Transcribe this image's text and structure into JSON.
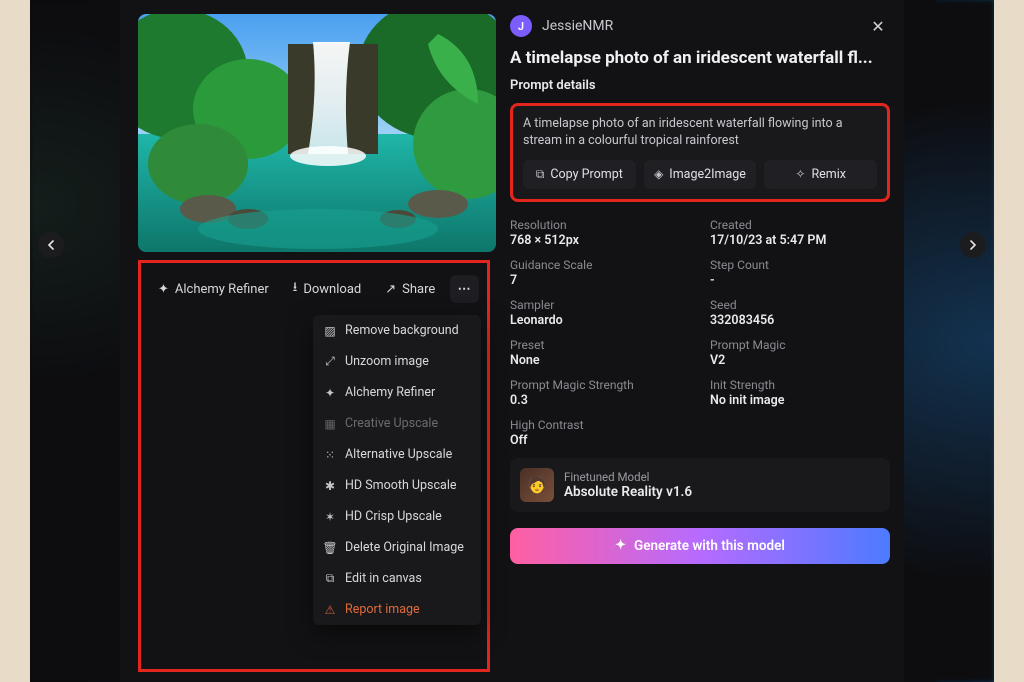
{
  "user": {
    "name": "JessieNMR",
    "initial": "J"
  },
  "title": "A timelapse photo of an iridescent waterfall fl...",
  "prompt_details_label": "Prompt details",
  "prompt_text": "A timelapse photo of an iridescent waterfall flowing into a stream in a colourful tropical rainforest",
  "prompt_actions": {
    "copy": "Copy Prompt",
    "i2i": "Image2Image",
    "remix": "Remix"
  },
  "toolbar": {
    "alchemy": "Alchemy Refiner",
    "download": "Download",
    "share": "Share"
  },
  "dropdown": [
    {
      "icon": "▨",
      "label": "Remove background"
    },
    {
      "icon": "⤢",
      "label": "Unzoom image"
    },
    {
      "icon": "✦",
      "label": "Alchemy Refiner"
    },
    {
      "icon": "▦",
      "label": "Creative Upscale",
      "disabled": true
    },
    {
      "icon": "⁙",
      "label": "Alternative Upscale"
    },
    {
      "icon": "✱",
      "label": "HD Smooth Upscale"
    },
    {
      "icon": "✶",
      "label": "HD Crisp Upscale"
    },
    {
      "icon": "🗑",
      "label": "Delete Original Image"
    },
    {
      "icon": "⧉",
      "label": "Edit in canvas"
    },
    {
      "icon": "⚠",
      "label": "Report image",
      "danger": true
    }
  ],
  "meta": [
    {
      "label": "Resolution",
      "value": "768 × 512px"
    },
    {
      "label": "Created",
      "value": "17/10/23 at 5:47 PM"
    },
    {
      "label": "Guidance Scale",
      "value": "7"
    },
    {
      "label": "Step Count",
      "value": "-"
    },
    {
      "label": "Sampler",
      "value": "Leonardo"
    },
    {
      "label": "Seed",
      "value": "332083456"
    },
    {
      "label": "Preset",
      "value": "None"
    },
    {
      "label": "Prompt Magic",
      "value": "V2"
    },
    {
      "label": "Prompt Magic Strength",
      "value": "0.3"
    },
    {
      "label": "Init Strength",
      "value": "No init image"
    },
    {
      "label": "High Contrast",
      "value": "Off"
    }
  ],
  "model": {
    "label": "Finetuned Model",
    "name": "Absolute Reality v1.6"
  },
  "generate_label": "Generate with this model"
}
